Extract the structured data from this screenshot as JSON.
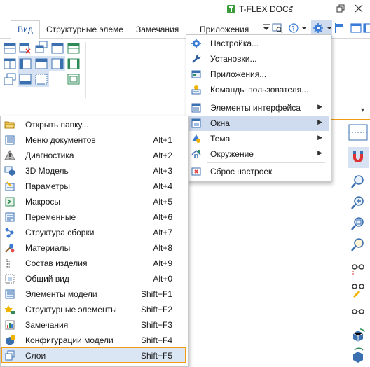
{
  "titlebar": {
    "app_title": "T-FLEX DOCs",
    "caret": "▾"
  },
  "tabs": [
    {
      "label": "Вид"
    },
    {
      "label": "Структурные элеме"
    },
    {
      "label": "Замечания"
    },
    {
      "label": "Приложения"
    }
  ],
  "combo": {
    "caret": "▾"
  },
  "settings_menu": {
    "items": [
      {
        "label": "Настройка...",
        "icon": "settings-icon"
      },
      {
        "label": "Установки...",
        "icon": "wrench-icon"
      },
      {
        "label": "Приложения...",
        "icon": "applications-icon"
      },
      {
        "label": "Команды пользователя...",
        "icon": "user-commands-icon"
      },
      {
        "label": "Элементы интерфейса",
        "icon": "interface-elements-icon",
        "submenu": true
      },
      {
        "label": "Окна",
        "icon": "windows-icon",
        "submenu": true,
        "active": true
      },
      {
        "label": "Тема",
        "icon": "theme-icon",
        "submenu": true
      },
      {
        "label": "Окружение",
        "icon": "environment-icon",
        "submenu": true
      },
      {
        "label": "Сброс настроек",
        "icon": "reset-icon"
      }
    ],
    "arrow": "▶"
  },
  "windows_menu": {
    "items": [
      {
        "label": "Открыть папку...",
        "shortcut": "",
        "icon": "folder-open-icon"
      },
      {
        "label": "Меню документов",
        "shortcut": "Alt+1",
        "icon": "document-menu-icon"
      },
      {
        "label": "Диагностика",
        "shortcut": "Alt+2",
        "icon": "warning-icon"
      },
      {
        "label": "3D Модель",
        "shortcut": "Alt+3",
        "icon": "model-3d-icon"
      },
      {
        "label": "Параметры",
        "shortcut": "Alt+4",
        "icon": "parameters-icon"
      },
      {
        "label": "Макросы",
        "shortcut": "Alt+5",
        "icon": "macros-icon"
      },
      {
        "label": "Переменные",
        "shortcut": "Alt+6",
        "icon": "variables-icon"
      },
      {
        "label": "Структура сборки",
        "shortcut": "Alt+7",
        "icon": "assembly-structure-icon"
      },
      {
        "label": "Материалы",
        "shortcut": "Alt+8",
        "icon": "materials-icon"
      },
      {
        "label": "Состав изделия",
        "shortcut": "Alt+9",
        "icon": "product-composition-icon"
      },
      {
        "label": "Общий вид",
        "shortcut": "Alt+0",
        "icon": "general-view-icon"
      },
      {
        "label": "Элементы модели",
        "shortcut": "Shift+F1",
        "icon": "model-elements-icon"
      },
      {
        "label": "Структурные элементы",
        "shortcut": "Shift+F2",
        "icon": "structural-elements-icon"
      },
      {
        "label": "Замечания",
        "shortcut": "Shift+F3",
        "icon": "notes-icon"
      },
      {
        "label": "Конфигурации модели",
        "shortcut": "Shift+F4",
        "icon": "model-configurations-icon"
      },
      {
        "label": "Слои",
        "shortcut": "Shift+F5",
        "icon": "layers-icon",
        "highlighted": true
      }
    ]
  },
  "colors": {
    "accent_orange": "#f39c12",
    "menu_active": "#cfdcef",
    "tab_active_text": "#2a5ea8",
    "logo_green": "#3a9d3a"
  }
}
